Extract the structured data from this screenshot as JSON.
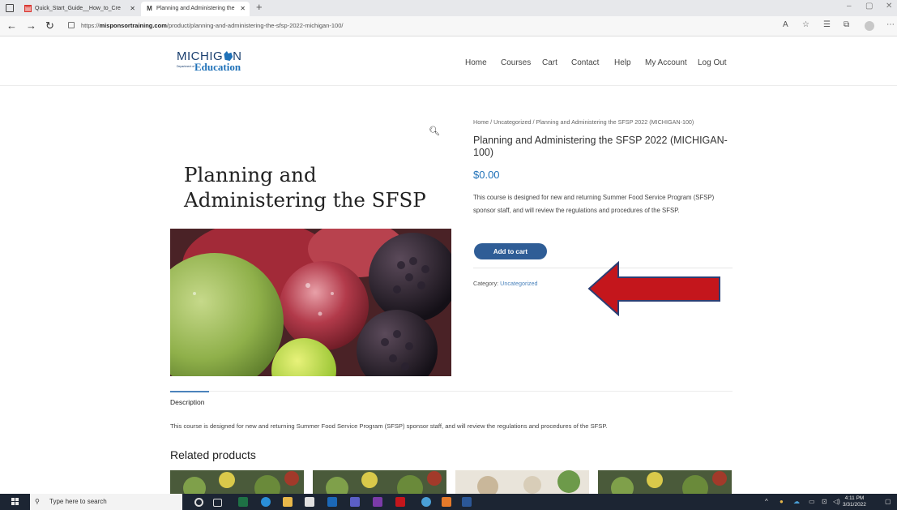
{
  "browser": {
    "tabs": [
      {
        "label": "Quick_Start_Guide__How_to_Cre",
        "icon": "pdf-icon"
      },
      {
        "label": "Planning and Administering the",
        "icon": "site-m-icon"
      }
    ],
    "favicon_letter": "M",
    "url_prefix": "https://",
    "url_domain": "misponsortraining.com",
    "url_path": "/product/planning-and-administering-the-sfsp-2022-michigan-100/"
  },
  "site": {
    "logo_top": "MICHIG",
    "logo_top_end": "N",
    "logo_bottom": "Education",
    "logo_dept": "Department of",
    "nav": [
      "Home",
      "Courses",
      "Cart",
      "Contact",
      "Help",
      "My Account",
      "Log Out"
    ]
  },
  "product": {
    "image_title_line1": "Planning and",
    "image_title_line2": "Administering the SFSP",
    "breadcrumb": "Home / Uncategorized / Planning and Administering the SFSP 2022 (MICHIGAN-100)",
    "title": "Planning and Administering the SFSP 2022 (MICHIGAN-100)",
    "price": "$0.00",
    "short_description": "This course is designed for new and returning Summer Food Service Program (SFSP) sponsor staff, and will review the regulations and procedures of the SFSP.",
    "add_to_cart": "Add to cart",
    "category_label": "Category:",
    "category_value": "Uncategorized"
  },
  "tabs": {
    "description_tab": "Description",
    "description_text": "This course is designed for new and returning Summer Food Service Program (SFSP) sponsor staff, and will review the regulations and procedures of the SFSP."
  },
  "related": {
    "heading": "Related products"
  },
  "taskbar": {
    "search_placeholder": "Type here to search",
    "time": "4:11 PM",
    "date": "3/31/2022"
  },
  "colors": {
    "accent": "#1f71b8",
    "button": "#2f5d96",
    "arrow": "#c4161c"
  }
}
